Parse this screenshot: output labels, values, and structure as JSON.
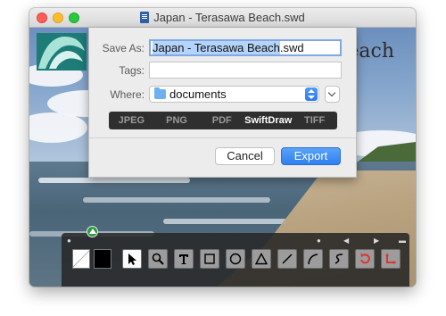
{
  "window": {
    "title": "Japan - Terasawa Beach.swd"
  },
  "canvas": {
    "title_fragment": "each"
  },
  "save_sheet": {
    "save_as_label": "Save As:",
    "filename_selected": "Japan - Terasawa Beach",
    "filename_ext": ".swd",
    "tags_label": "Tags:",
    "tags_value": "",
    "where_label": "Where:",
    "where_value": "documents",
    "formats": [
      "JPEG",
      "PNG",
      "PDF",
      "SwiftDraw",
      "TIFF"
    ],
    "selected_format": "SwiftDraw",
    "cancel_label": "Cancel",
    "export_label": "Export"
  },
  "toolbar": {
    "tools": [
      "select-arrow",
      "zoom",
      "text",
      "rectangle",
      "ellipse",
      "triangle",
      "line",
      "arc",
      "bezier",
      "rotate",
      "flip"
    ],
    "selected_tool": "select-arrow",
    "colors": {
      "fill": "#000000",
      "accent_red": "#e0332f",
      "button_blue": "#2f7ff0"
    }
  }
}
